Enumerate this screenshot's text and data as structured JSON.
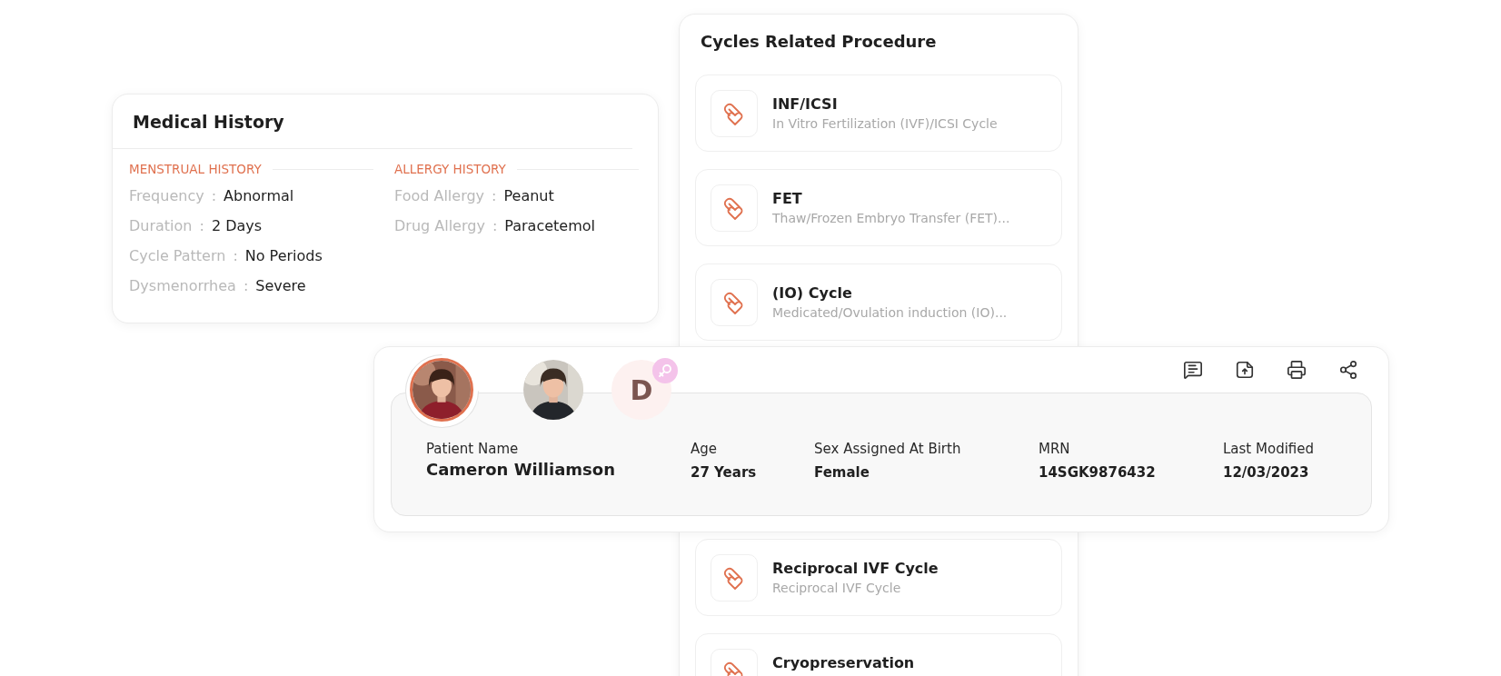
{
  "medical_history": {
    "title": "Medical History",
    "sections": [
      {
        "heading": "MENSTRUAL HISTORY",
        "fields": [
          {
            "label": "Frequency",
            "separator": ":",
            "value": "Abnormal"
          },
          {
            "label": "Duration",
            "separator": ":",
            "value": "2 Days"
          },
          {
            "label": "Cycle Pattern",
            "separator": ":",
            "value": "No Periods"
          },
          {
            "label": "Dysmenorrhea",
            "separator": ":",
            "value": "Severe"
          }
        ]
      },
      {
        "heading": "ALLERGY HISTORY",
        "fields": [
          {
            "label": "Food Allergy",
            "separator": ":",
            "value": "Peanut"
          },
          {
            "label": "Drug Allergy",
            "separator": ":",
            "value": "Paracetemol"
          }
        ]
      }
    ]
  },
  "cycles_related_procedure": {
    "title": "Cycles Related Procedure",
    "items": [
      {
        "title": "INF/ICSI",
        "subtitle": "In Vitro Fertilization (IVF)/ICSI Cycle"
      },
      {
        "title": "FET",
        "subtitle": "Thaw/Frozen Embryo Transfer (FET)..."
      },
      {
        "title": "(IO) Cycle",
        "subtitle": "Medicated/Ovulation induction (IO)..."
      },
      {
        "title": "Reciprocal IVF Cycle",
        "subtitle": "Reciprocal IVF Cycle"
      },
      {
        "title": "Cryopreservation"
      }
    ]
  },
  "patient_card": {
    "avatars": [
      {
        "kind": "picture",
        "selected": true
      },
      {
        "kind": "picture",
        "selected": false
      },
      {
        "kind": "initial",
        "initial": "D",
        "selected": false
      }
    ],
    "fields": [
      {
        "label": "Patient Name",
        "value": "Cameron Williamson",
        "kind": "primary"
      },
      {
        "label": "Age",
        "value": "27 Years",
        "kind": "plain"
      },
      {
        "label": "Sex Assigned At Birth",
        "value": "Female",
        "kind": "plain"
      },
      {
        "label": "MRN",
        "value": "14SGK9876432",
        "kind": "plain"
      },
      {
        "label": "Last Modified",
        "value": "12/03/2023",
        "kind": "plain"
      }
    ]
  }
}
